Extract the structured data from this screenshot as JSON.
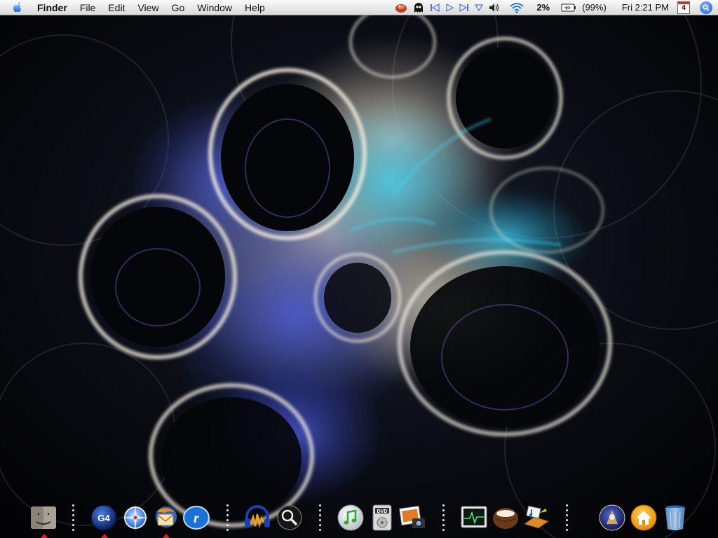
{
  "menubar": {
    "app_name": "Finder",
    "menus": [
      "File",
      "Edit",
      "View",
      "Go",
      "Window",
      "Help"
    ],
    "battery_percent": "2%",
    "battery_status": "(99%)",
    "clock": "Fri 2:21 PM",
    "calendar_day": "4",
    "status_icons": [
      "menu-extra-icon",
      "ghost-icon",
      "previous-track-icon",
      "play-icon",
      "next-track-icon",
      "triangle-menu-icon",
      "volume-icon",
      "wifi-icon",
      "battery-icon",
      "calendar-icon",
      "spotlight-icon"
    ]
  },
  "dock": {
    "items": [
      {
        "name": "finder",
        "icon": "finder-icon",
        "running": true
      },
      {
        "name": "g4",
        "icon": "g4-icon",
        "label": "G4",
        "running": true
      },
      {
        "name": "safari",
        "icon": "compass-icon",
        "running": false
      },
      {
        "name": "thunderbird",
        "icon": "mail-bird-icon",
        "running": true
      },
      {
        "name": "realplayer",
        "icon": "realplayer-icon",
        "running": false
      },
      {
        "name": "audacity",
        "icon": "audio-headphones-icon",
        "running": false
      },
      {
        "name": "magnifier",
        "icon": "magnifier-icon",
        "running": false
      },
      {
        "name": "itunes",
        "icon": "itunes-icon",
        "running": false
      },
      {
        "name": "dvd-player",
        "icon": "dvd-player-icon",
        "label": "DVD",
        "running": false
      },
      {
        "name": "iphoto",
        "icon": "photo-icon",
        "running": false
      },
      {
        "name": "activity-monitor",
        "icon": "activity-monitor-icon",
        "running": false
      },
      {
        "name": "coconut",
        "icon": "coconut-icon",
        "running": false
      },
      {
        "name": "music-manager",
        "icon": "music-folder-icon",
        "running": false
      },
      {
        "name": "dashboard",
        "icon": "dashboard-icon",
        "running": false
      },
      {
        "name": "home",
        "icon": "home-icon",
        "running": false
      },
      {
        "name": "trash",
        "icon": "trash-icon",
        "running": false
      }
    ]
  },
  "colors": {
    "accent_blue": "#1a5fd4",
    "wallpaper_dark": "#07080c",
    "fractal_light": "#e8e4da",
    "fractal_cyan": "#34c3e8",
    "fractal_blue": "#3c4ec8",
    "running_indicator": "#e02020"
  }
}
